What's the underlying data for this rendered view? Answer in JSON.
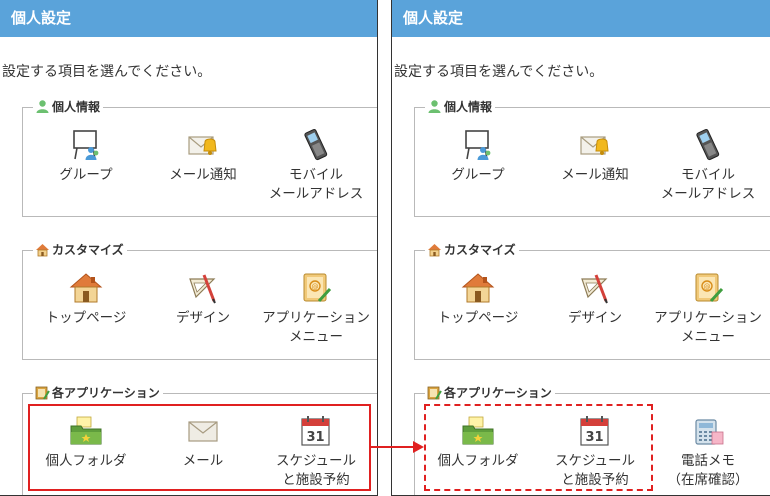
{
  "left": {
    "header": "個人設定",
    "intro": "設定する項目を選んでください。",
    "sections": [
      {
        "title": "個人情報",
        "icon": "person-icon",
        "items": [
          {
            "label": "グループ",
            "icon": "group-board-icon"
          },
          {
            "label": "メール通知",
            "icon": "mail-notify-icon"
          },
          {
            "label": "モバイル\nメールアドレス",
            "icon": "mobile-phone-icon"
          }
        ]
      },
      {
        "title": "カスタマイズ",
        "icon": "home-small-icon",
        "items": [
          {
            "label": "トップページ",
            "icon": "house-icon"
          },
          {
            "label": "デザイン",
            "icon": "design-icon"
          },
          {
            "label": "アプリケーション\nメニュー",
            "icon": "app-menu-icon"
          }
        ]
      },
      {
        "title": "各アプリケーション",
        "icon": "apps-book-icon",
        "items": [
          {
            "label": "個人フォルダ",
            "icon": "folder-icon"
          },
          {
            "label": "メール",
            "icon": "envelope-icon"
          },
          {
            "label": "スケジュール\nと施設予約",
            "icon": "calendar-icon"
          }
        ]
      }
    ]
  },
  "right": {
    "header": "個人設定",
    "intro": "設定する項目を選んでください。",
    "sections": [
      {
        "title": "個人情報",
        "icon": "person-icon",
        "items": [
          {
            "label": "グループ",
            "icon": "group-board-icon"
          },
          {
            "label": "メール通知",
            "icon": "mail-notify-icon"
          },
          {
            "label": "モバイル\nメールアドレス",
            "icon": "mobile-phone-icon"
          }
        ]
      },
      {
        "title": "カスタマイズ",
        "icon": "home-small-icon",
        "items": [
          {
            "label": "トップページ",
            "icon": "house-icon"
          },
          {
            "label": "デザイン",
            "icon": "design-icon"
          },
          {
            "label": "アプリケーション\nメニュー",
            "icon": "app-menu-icon"
          }
        ]
      },
      {
        "title": "各アプリケーション",
        "icon": "apps-book-icon",
        "items": [
          {
            "label": "個人フォルダ",
            "icon": "folder-icon"
          },
          {
            "label": "スケジュール\nと施設予約",
            "icon": "calendar-icon"
          },
          {
            "label": "電話メモ\n（在席確認）",
            "icon": "phone-memo-icon"
          }
        ]
      }
    ]
  },
  "colors": {
    "header_bg": "#5aa3da",
    "highlight": "#e02020",
    "section_border": "#b9b9b9"
  },
  "calendar_day": "31"
}
